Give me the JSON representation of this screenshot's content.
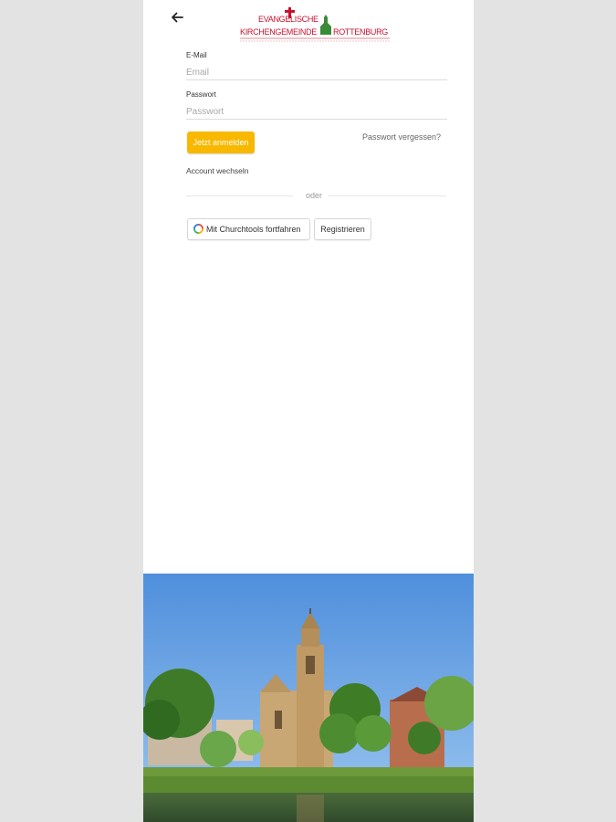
{
  "header": {
    "back_icon": "arrow-left-icon",
    "logo": {
      "line1": "EVANGELISCHE",
      "line2": "KIRCHENGEMEINDE",
      "line3": "ROTTENBURG",
      "brand_color": "#c8102e",
      "accent_color": "#3a8a3a"
    }
  },
  "form": {
    "email_label": "E-Mail",
    "email_placeholder": "Email",
    "password_label": "Passwort",
    "password_placeholder": "Passwort",
    "login_button": "Jetzt anmelden",
    "forgot_link": "Passwort vergessen?",
    "switch_account": "Account wechseln",
    "divider_text": "oder",
    "churchtools_button": "Mit Churchtools fortfahren",
    "register_button": "Registrieren"
  },
  "colors": {
    "primary": "#f8b800",
    "panel_background": "#ffffff",
    "page_background": "#e3e3e3"
  }
}
